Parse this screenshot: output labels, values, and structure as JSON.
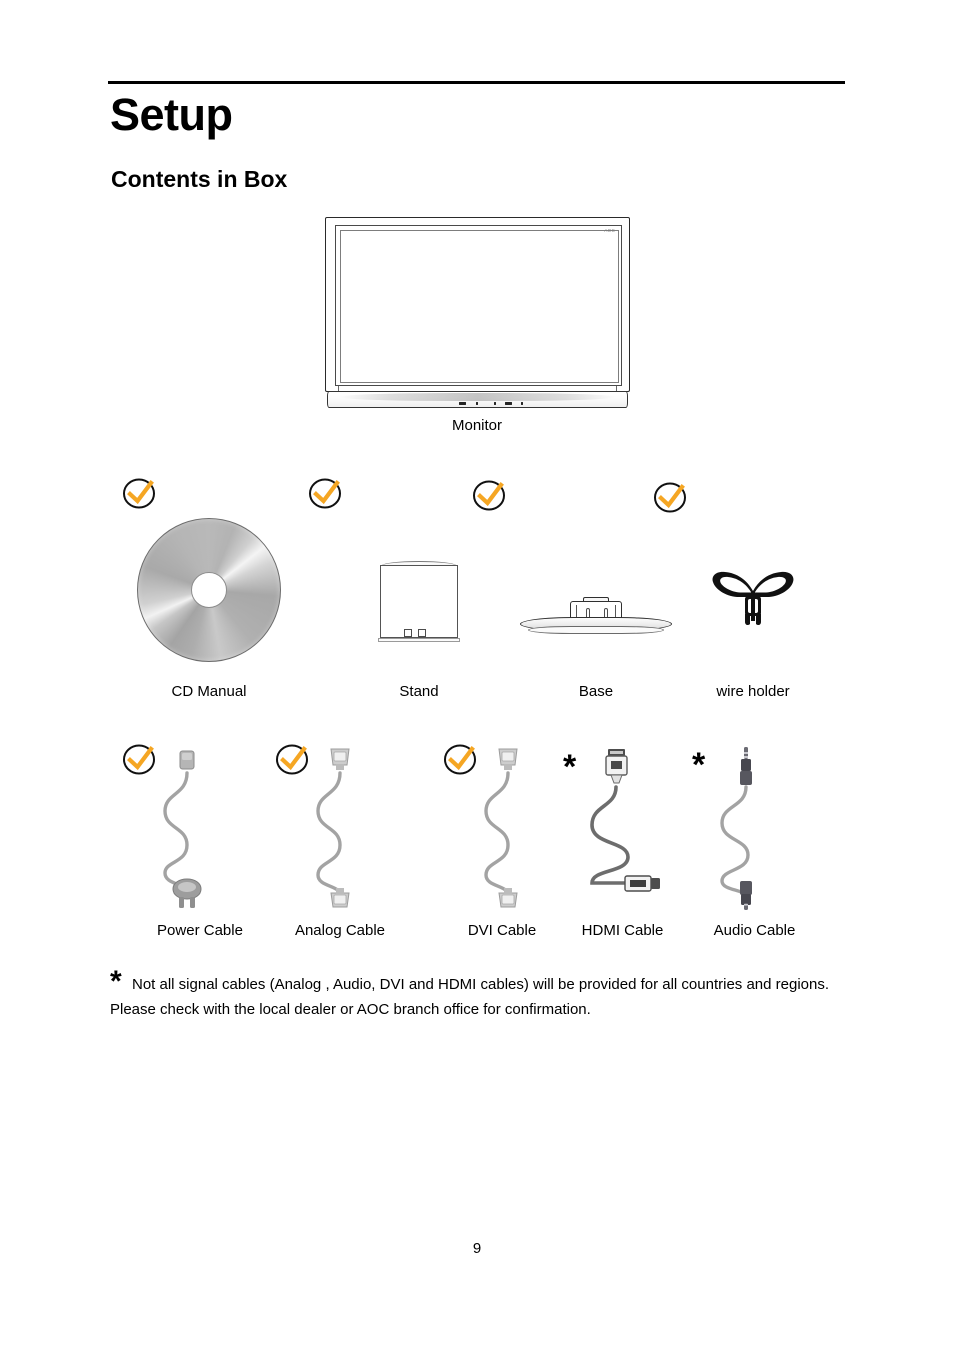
{
  "document": {
    "heading": "Setup",
    "subheading": "Contents in Box",
    "page_number": "9"
  },
  "monitor": {
    "caption": "Monitor",
    "brand_logo": "AOC",
    "icon": "monitor-icon"
  },
  "items_row1": [
    {
      "label": "CD Manual",
      "marker": "check",
      "icon": "cd-disc-icon"
    },
    {
      "label": "Stand",
      "marker": "check",
      "icon": "monitor-stand-icon"
    },
    {
      "label": "Base",
      "marker": "check",
      "icon": "monitor-base-icon"
    },
    {
      "label": "wire holder",
      "marker": "check",
      "icon": "wire-holder-icon"
    }
  ],
  "items_row2": [
    {
      "label": "Power Cable",
      "marker": "check",
      "icon": "power-cable-icon"
    },
    {
      "label": "Analog Cable",
      "marker": "check",
      "icon": "vga-cable-icon"
    },
    {
      "label": "DVI Cable",
      "marker": "check",
      "icon": "dvi-cable-icon"
    },
    {
      "label": "HDMI Cable",
      "marker": "asterisk",
      "icon": "hdmi-cable-icon"
    },
    {
      "label": "Audio Cable",
      "marker": "asterisk",
      "icon": "audio-cable-icon"
    }
  ],
  "footnote": {
    "marker": "*",
    "line1": "Not all signal cables (Analog , Audio, DVI and HDMI cables) will be provided for all countries and regions.",
    "line2": "Please check with the local dealer or AOC branch office for confirmation."
  },
  "colors": {
    "check_mark": "#F5A623",
    "check_ring": "#111111",
    "text": "#000000",
    "cable_gray": "#9a9a9a",
    "connector_gray": "#c9c9c9",
    "audio_connector": "#4a4a52"
  }
}
